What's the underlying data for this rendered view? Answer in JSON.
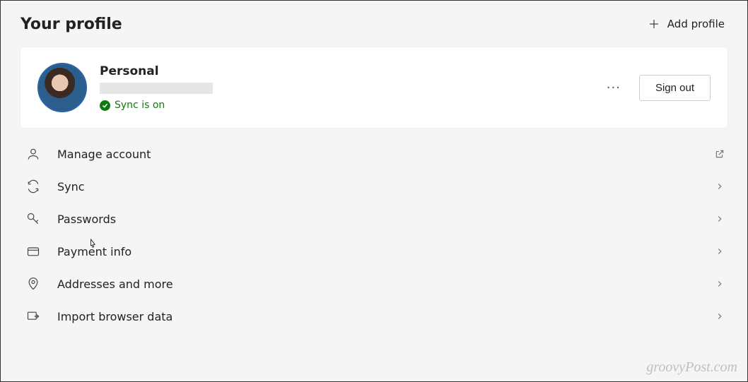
{
  "header": {
    "title": "Your profile",
    "add_profile_label": "Add profile"
  },
  "profile_card": {
    "name": "Personal",
    "sync_status": "Sync is on",
    "more_label": "···",
    "sign_out_label": "Sign out"
  },
  "menu": {
    "items": [
      {
        "label": "Manage account",
        "icon": "person-icon",
        "action": "external"
      },
      {
        "label": "Sync",
        "icon": "sync-icon",
        "action": "chevron"
      },
      {
        "label": "Passwords",
        "icon": "key-icon",
        "action": "chevron"
      },
      {
        "label": "Payment info",
        "icon": "card-icon",
        "action": "chevron"
      },
      {
        "label": "Addresses and more",
        "icon": "pin-icon",
        "action": "chevron"
      },
      {
        "label": "Import browser data",
        "icon": "import-icon",
        "action": "chevron"
      }
    ]
  },
  "watermark": "groovyPost.com"
}
